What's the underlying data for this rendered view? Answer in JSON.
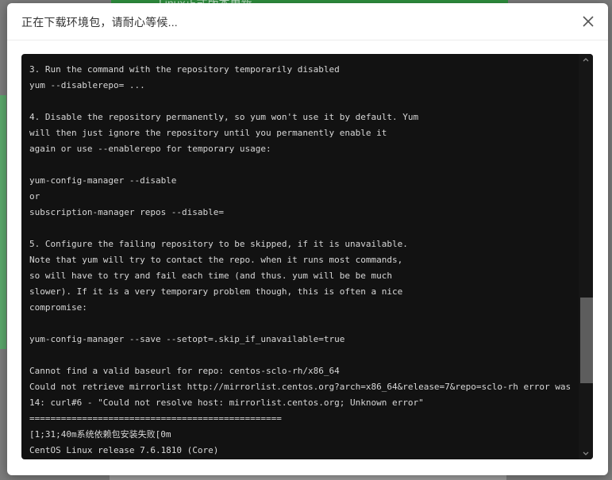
{
  "background": {
    "top_text": "Linux正式版本更新"
  },
  "modal": {
    "title": "正在下载环境包，请耐心等候..."
  },
  "terminal": {
    "lines": [
      "3. Run the command with the repository temporarily disabled",
      "yum --disablerepo= ...",
      "",
      "4. Disable the repository permanently, so yum won't use it by default. Yum",
      "will then just ignore the repository until you permanently enable it",
      "again or use --enablerepo for temporary usage:",
      "",
      "yum-config-manager --disable",
      "or",
      "subscription-manager repos --disable=",
      "",
      "5. Configure the failing repository to be skipped, if it is unavailable.",
      "Note that yum will try to contact the repo. when it runs most commands,",
      "so will have to try and fail each time (and thus. yum will be be much",
      "slower). If it is a very temporary problem though, this is often a nice",
      "compromise:",
      "",
      "yum-config-manager --save --setopt=.skip_if_unavailable=true",
      "",
      "Cannot find a valid baseurl for repo: centos-sclo-rh/x86_64",
      "Could not retrieve mirrorlist http://mirrorlist.centos.org?arch=x86_64&release=7&repo=sclo-rh error was",
      "14: curl#6 - \"Could not resolve host: mirrorlist.centos.org; Unknown error\"",
      "================================================",
      "[1;31;40m系统依赖包安装失败[0m",
      "CentOS Linux release 7.6.1810 (Core)"
    ],
    "scroll_position": 0.78
  },
  "colors": {
    "terminal_bg": "#121212",
    "terminal_text": "#d8d8d8",
    "overlay": "#7b7b7b"
  }
}
